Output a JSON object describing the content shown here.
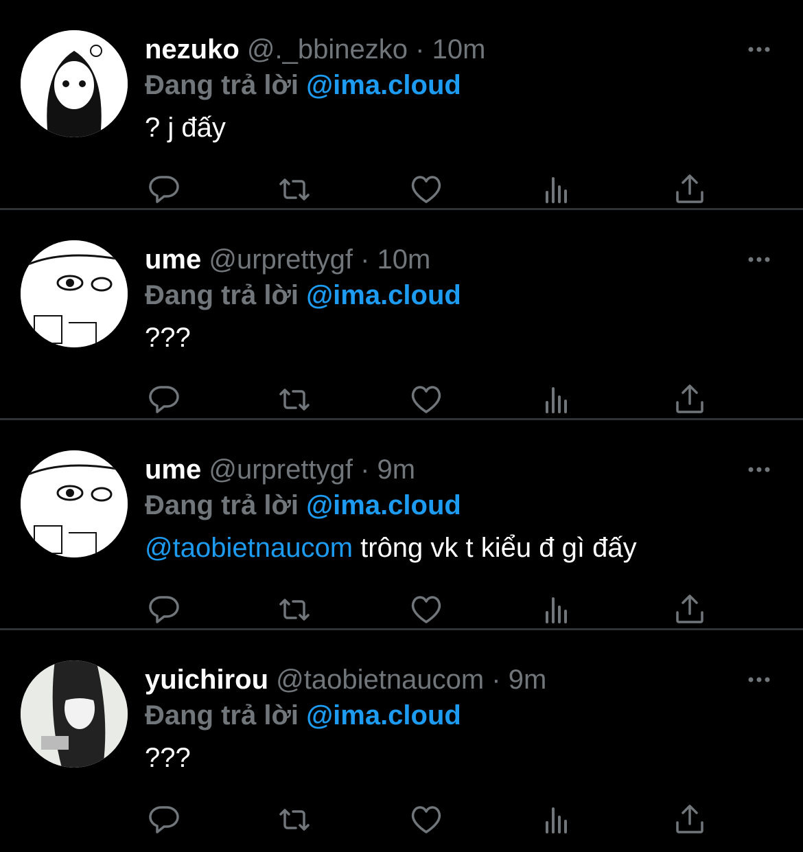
{
  "colors": {
    "background": "#000000",
    "secondary": "#71767b",
    "accent": "#1d9bf0",
    "divider": "#2f3336"
  },
  "icons": [
    "reply-icon",
    "retweet-icon",
    "like-icon",
    "views-icon",
    "share-icon",
    "more-icon"
  ],
  "tweets": [
    {
      "name": "nezuko",
      "handle": "@._bbinezko",
      "dot": "·",
      "time": "10m",
      "reply_prefix": "Đang trả lời ",
      "reply_to": "@ima.cloud",
      "mention": "",
      "text": "? j đấy"
    },
    {
      "name": "ume",
      "handle": "@urprettygf",
      "dot": "·",
      "time": "10m",
      "reply_prefix": "Đang trả lời ",
      "reply_to": "@ima.cloud",
      "mention": "",
      "text": "???"
    },
    {
      "name": "ume",
      "handle": "@urprettygf",
      "dot": "·",
      "time": "9m",
      "reply_prefix": "Đang trả lời ",
      "reply_to": "@ima.cloud",
      "mention": "@taobietnaucom",
      "text": " trông vk t kiểu đ gì đấy"
    },
    {
      "name": "yuichirou",
      "handle": "@taobietnaucom",
      "dot": "·",
      "time": "9m",
      "reply_prefix": "Đang trả lời ",
      "reply_to": "@ima.cloud",
      "mention": "",
      "text": "???"
    }
  ]
}
